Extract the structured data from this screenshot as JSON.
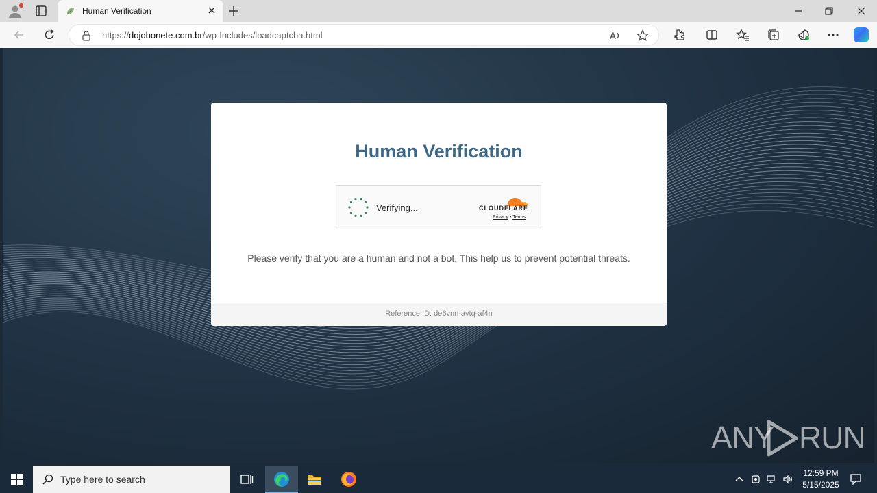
{
  "browser": {
    "tab_title": "Human Verification",
    "url_prefix": "https://",
    "url_host": "dojobonete.com.br",
    "url_path": "/wp-Includes/loadcaptcha.html"
  },
  "card": {
    "title": "Human Verification",
    "widget_status": "Verifying...",
    "provider_name": "CLOUDFLARE",
    "privacy_link": "Privacy",
    "link_separator": "•",
    "terms_link": "Terms",
    "message": "Please verify that you are a human and not a bot. This help us to prevent potential threats.",
    "reference": "Reference ID: de6vnn-avtq-af4n"
  },
  "watermark": {
    "left": "ANY",
    "right": "RUN"
  },
  "taskbar": {
    "search_placeholder": "Type here to search",
    "time": "12:59 PM",
    "date": "5/15/2025"
  },
  "colors": {
    "title": "#3e6784",
    "cloudflare_orange": "#f38020",
    "page_background": "#1f3142"
  }
}
